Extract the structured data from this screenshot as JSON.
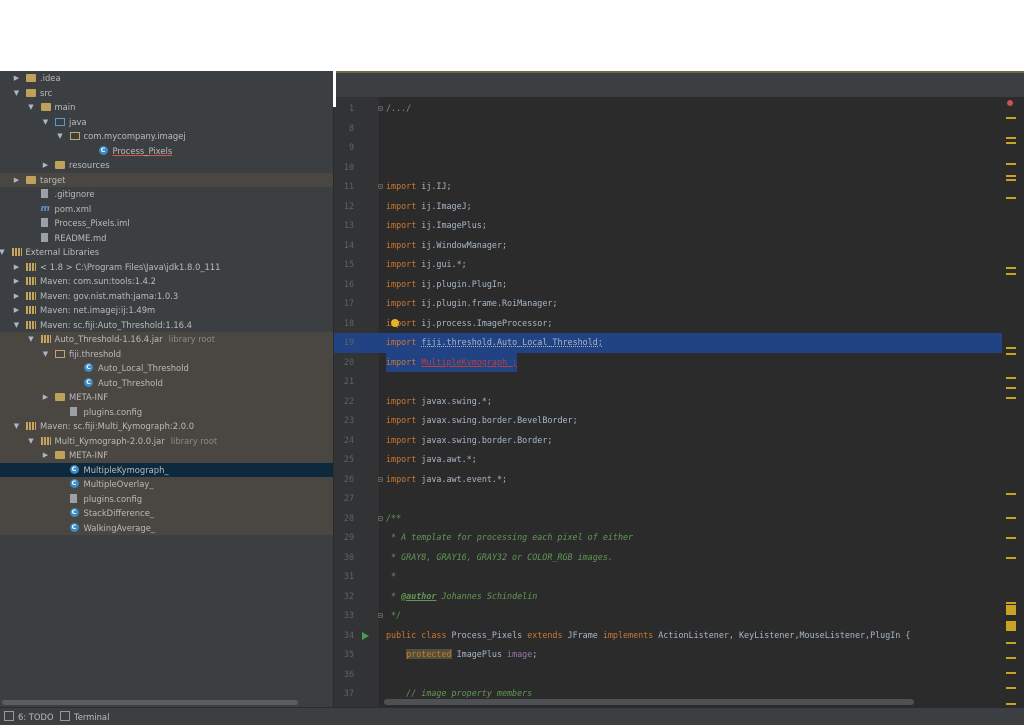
{
  "tree": {
    "items": [
      {
        "label": ".idea",
        "hint": "",
        "depth": 0,
        "arrow": "▶",
        "icon": "folder",
        "state": "normal"
      },
      {
        "label": "src",
        "hint": "",
        "depth": 0,
        "arrow": "▼",
        "icon": "folder",
        "state": "normal"
      },
      {
        "label": "main",
        "hint": "",
        "depth": 1,
        "arrow": "▼",
        "icon": "folder",
        "state": "normal"
      },
      {
        "label": "java",
        "hint": "",
        "depth": 2,
        "arrow": "▼",
        "icon": "folder-src",
        "state": "normal"
      },
      {
        "label": "com.mycompany.imagej",
        "hint": "",
        "depth": 3,
        "arrow": "▼",
        "icon": "pkg",
        "state": "normal"
      },
      {
        "label": "Process_Pixels",
        "hint": "",
        "depth": 5,
        "arrow": "",
        "icon": "class",
        "state": "normal"
      },
      {
        "label": "resources",
        "hint": "",
        "depth": 2,
        "arrow": "▶",
        "icon": "folder",
        "state": "normal"
      },
      {
        "label": "target",
        "hint": "",
        "depth": 0,
        "arrow": "▶",
        "icon": "folder",
        "state": "hl"
      },
      {
        "label": ".gitignore",
        "hint": "",
        "depth": 1,
        "arrow": "",
        "icon": "file",
        "state": "normal"
      },
      {
        "label": "pom.xml",
        "hint": "",
        "depth": 1,
        "arrow": "",
        "icon": "maven",
        "state": "normal"
      },
      {
        "label": "Process_Pixels.iml",
        "hint": "",
        "depth": 1,
        "arrow": "",
        "icon": "file",
        "state": "normal"
      },
      {
        "label": "README.md",
        "hint": "",
        "depth": 1,
        "arrow": "",
        "icon": "file",
        "state": "normal"
      },
      {
        "label": "External Libraries",
        "hint": "",
        "depth": -1,
        "arrow": "▼",
        "icon": "lib",
        "state": "normal"
      },
      {
        "label": "< 1.8 >  C:\\Program Files\\Java\\jdk1.8.0_111",
        "hint": "",
        "depth": 0,
        "arrow": "▶",
        "icon": "lib",
        "state": "normal"
      },
      {
        "label": "Maven: com.sun:tools:1.4.2",
        "hint": "",
        "depth": 0,
        "arrow": "▶",
        "icon": "lib",
        "state": "normal"
      },
      {
        "label": "Maven: gov.nist.math:jama:1.0.3",
        "hint": "",
        "depth": 0,
        "arrow": "▶",
        "icon": "lib",
        "state": "normal"
      },
      {
        "label": "Maven: net.imagej:ij:1.49m",
        "hint": "",
        "depth": 0,
        "arrow": "▶",
        "icon": "lib",
        "state": "normal"
      },
      {
        "label": "Maven: sc.fiji:Auto_Threshold:1.16.4",
        "hint": "",
        "depth": 0,
        "arrow": "▼",
        "icon": "lib",
        "state": "normal"
      },
      {
        "label": "Auto_Threshold-1.16.4.jar",
        "hint": "library root",
        "depth": 1,
        "arrow": "▼",
        "icon": "jar",
        "state": "hl"
      },
      {
        "label": "fiji.threshold",
        "hint": "",
        "depth": 2,
        "arrow": "▼",
        "icon": "pkg",
        "state": "hl"
      },
      {
        "label": "Auto_Local_Threshold",
        "hint": "",
        "depth": 4,
        "arrow": "",
        "icon": "class",
        "state": "hl"
      },
      {
        "label": "Auto_Threshold",
        "hint": "",
        "depth": 4,
        "arrow": "",
        "icon": "class",
        "state": "hl"
      },
      {
        "label": "META-INF",
        "hint": "",
        "depth": 2,
        "arrow": "▶",
        "icon": "folder",
        "state": "hl"
      },
      {
        "label": "plugins.config",
        "hint": "",
        "depth": 3,
        "arrow": "",
        "icon": "file",
        "state": "hl"
      },
      {
        "label": "Maven: sc.fiji:Multi_Kymograph:2.0.0",
        "hint": "",
        "depth": 0,
        "arrow": "▼",
        "icon": "lib",
        "state": "hl"
      },
      {
        "label": "Multi_Kymograph-2.0.0.jar",
        "hint": "library root",
        "depth": 1,
        "arrow": "▼",
        "icon": "jar",
        "state": "hl"
      },
      {
        "label": "META-INF",
        "hint": "",
        "depth": 2,
        "arrow": "▶",
        "icon": "folder",
        "state": "hl"
      },
      {
        "label": "MultipleKymograph_",
        "hint": "",
        "depth": 3,
        "arrow": "",
        "icon": "class",
        "state": "sel"
      },
      {
        "label": "MultipleOverlay_",
        "hint": "",
        "depth": 3,
        "arrow": "",
        "icon": "class",
        "state": "hl"
      },
      {
        "label": "plugins.config",
        "hint": "",
        "depth": 3,
        "arrow": "",
        "icon": "file",
        "state": "hl"
      },
      {
        "label": "StackDifference_",
        "hint": "",
        "depth": 3,
        "arrow": "",
        "icon": "class",
        "state": "hl"
      },
      {
        "label": "WalkingAverage_",
        "hint": "",
        "depth": 3,
        "arrow": "",
        "icon": "class",
        "state": "hl"
      }
    ]
  },
  "editor": {
    "lines": [
      {
        "n": "1",
        "html": "<span class='fold'>/.../</span>",
        "state": "",
        "fold": "⊟"
      },
      {
        "n": "8",
        "html": "",
        "state": "",
        "fold": ""
      },
      {
        "n": "9",
        "html": "",
        "state": "",
        "fold": ""
      },
      {
        "n": "10",
        "html": "",
        "state": "",
        "fold": ""
      },
      {
        "n": "11",
        "html": "<span class='kw'>import</span> ij.IJ;",
        "state": "",
        "fold": "⊟"
      },
      {
        "n": "12",
        "html": "<span class='kw'>import</span> ij.ImageJ;",
        "state": "",
        "fold": ""
      },
      {
        "n": "13",
        "html": "<span class='kw'>import</span> ij.ImagePlus;",
        "state": "",
        "fold": ""
      },
      {
        "n": "14",
        "html": "<span class='kw'>import</span> ij.WindowManager;",
        "state": "",
        "fold": ""
      },
      {
        "n": "15",
        "html": "<span class='kw'>import</span> ij.gui.*;",
        "state": "",
        "fold": ""
      },
      {
        "n": "16",
        "html": "<span class='kw'>import</span> ij.plugin.PlugIn;",
        "state": "",
        "fold": ""
      },
      {
        "n": "17",
        "html": "<span class='kw'>import</span> ij.plugin.frame.RoiManager;",
        "state": "",
        "fold": ""
      },
      {
        "n": "18",
        "html": "<span class='kw'>import</span> ij.process.ImageProcessor;",
        "state": "bulb",
        "fold": ""
      },
      {
        "n": "19",
        "html": "<span class='kw'>import</span> <span class='strike-u'>fiji.threshold.Auto_Local_Threshold;</span>",
        "state": "sel",
        "fold": ""
      },
      {
        "n": "20",
        "html": "<span class='kw'>import</span> <span class='bad'>MultipleKymograph_;</span>",
        "state": "sel-partial",
        "fold": ""
      },
      {
        "n": "21",
        "html": "",
        "state": "",
        "fold": ""
      },
      {
        "n": "22",
        "html": "<span class='kw'>import</span> javax.swing.*;",
        "state": "",
        "fold": ""
      },
      {
        "n": "23",
        "html": "<span class='kw'>import</span> javax.swing.border.BevelBorder;",
        "state": "",
        "fold": ""
      },
      {
        "n": "24",
        "html": "<span class='kw'>import</span> javax.swing.border.Border;",
        "state": "",
        "fold": ""
      },
      {
        "n": "25",
        "html": "<span class='kw'>import</span> java.awt.*;",
        "state": "",
        "fold": ""
      },
      {
        "n": "26",
        "html": "<span class='kw'>import</span> java.awt.event.*;",
        "state": "",
        "fold": "⊟"
      },
      {
        "n": "27",
        "html": "",
        "state": "",
        "fold": ""
      },
      {
        "n": "28",
        "html": "<span class='cm'>/**</span>",
        "state": "",
        "fold": "⊟"
      },
      {
        "n": "29",
        "html": "<span class='cm'> * A template for processing each pixel of either</span>",
        "state": "",
        "fold": ""
      },
      {
        "n": "30",
        "html": "<span class='cm'> * GRAY8, GRAY16, GRAY32 or COLOR_RGB images.</span>",
        "state": "",
        "fold": ""
      },
      {
        "n": "31",
        "html": "<span class='cm'> *</span>",
        "state": "",
        "fold": ""
      },
      {
        "n": "32",
        "html": "<span class='cm'> * </span><span class='cmtag'>@author</span><span class='cm'> Johannes Schindelin</span>",
        "state": "",
        "fold": ""
      },
      {
        "n": "33",
        "html": "<span class='cm'> */</span>",
        "state": "",
        "fold": "⊟"
      },
      {
        "n": "34",
        "html": "<span class='kw'>public class</span> Process_Pixels <span class='kw'>extends</span> JFrame <span class='kw'>implements</span> ActionListener, KeyListener,MouseListener,PlugIn {",
        "state": "run",
        "fold": ""
      },
      {
        "n": "35",
        "html": "    <span class='kw prot'>protected</span> ImagePlus <span class='field'>image</span>;",
        "state": "",
        "fold": ""
      },
      {
        "n": "36",
        "html": "",
        "state": "",
        "fold": ""
      },
      {
        "n": "37",
        "html": "    <span class='cm'>// image property members</span>",
        "state": "",
        "fold": ""
      }
    ]
  },
  "statusbar": {
    "todo_label": "6: TODO",
    "terminal_label": "Terminal"
  },
  "colors": {
    "panel_bg": "#3c3f41",
    "editor_bg": "#2b2b2b",
    "selection": "#214283",
    "keyword": "#cc7832",
    "comment": "#629755",
    "error": "#bc3f3c"
  }
}
